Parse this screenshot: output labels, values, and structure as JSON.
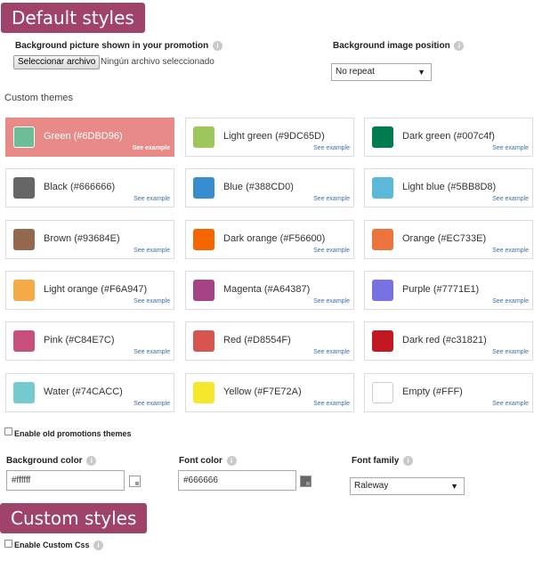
{
  "default_styles": {
    "title": "Default styles",
    "bg_picture": {
      "label": "Background picture shown in your promotion",
      "button": "Seleccionar archivo",
      "status": "Ningún archivo seleccionado"
    },
    "bg_position": {
      "label": "Background image position",
      "value": "No repeat"
    },
    "custom_themes_label": "Custom themes",
    "see_example": "See example",
    "themes": [
      {
        "name": "Green (#6DBD96)",
        "color": "#6DBD96",
        "selected": true
      },
      {
        "name": "Light green (#9DC65D)",
        "color": "#9DC65D"
      },
      {
        "name": "Dark green (#007c4f)",
        "color": "#007c4f"
      },
      {
        "name": "Black (#666666)",
        "color": "#666666"
      },
      {
        "name": "Blue (#388CD0)",
        "color": "#388CD0"
      },
      {
        "name": "Light blue (#5BB8D8)",
        "color": "#5BB8D8"
      },
      {
        "name": "Brown (#93684E)",
        "color": "#93684E"
      },
      {
        "name": "Dark orange (#F56600)",
        "color": "#F56600"
      },
      {
        "name": "Orange (#EC733E)",
        "color": "#EC733E"
      },
      {
        "name": "Light orange (#F6A947)",
        "color": "#F6A947"
      },
      {
        "name": "Magenta (#A64387)",
        "color": "#A64387"
      },
      {
        "name": "Purple (#7771E1)",
        "color": "#7771E1"
      },
      {
        "name": "Pink (#C84E7C)",
        "color": "#C84E7C"
      },
      {
        "name": "Red (#D8554F)",
        "color": "#D8554F"
      },
      {
        "name": "Dark red (#c31821)",
        "color": "#c31821"
      },
      {
        "name": "Water (#74CACC)",
        "color": "#74CACC"
      },
      {
        "name": "Yellow (#F7E72A)",
        "color": "#F7E72A"
      },
      {
        "name": "Empty (#FFF)",
        "color": "#FFFFFF"
      }
    ],
    "old_themes_label": "Enable old promotions themes",
    "bg_color": {
      "label": "Background color",
      "value": "#ffffff"
    },
    "font_color": {
      "label": "Font color",
      "value": "#666666"
    },
    "font_family": {
      "label": "Font family",
      "value": "Raleway"
    }
  },
  "custom_styles": {
    "title": "Custom styles",
    "enable_css_label": "Enable Custom Css"
  },
  "info_glyph": "i",
  "dropdown_glyph": "▼"
}
